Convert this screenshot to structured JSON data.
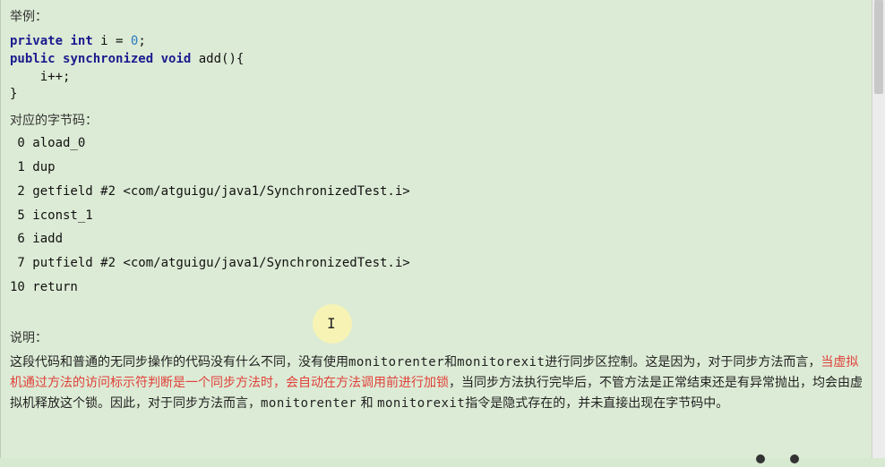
{
  "heading_example": "举例：",
  "code": {
    "line1": {
      "kw1": "private",
      "kw2": "int",
      "rest": " i = ",
      "num": "0",
      "end": ";"
    },
    "line2": {
      "kw1": "public",
      "kw2": "synchronized",
      "kw3": "void",
      "rest": " add(){"
    },
    "line3": "    i++;",
    "line4": "}"
  },
  "heading_bytecode": "对应的字节码：",
  "bytecode": [
    " 0 aload_0",
    " 1 dup",
    " 2 getfield #2 <com/atguigu/java1/SynchronizedTest.i>",
    " 5 iconst_1",
    " 6 iadd",
    " 7 putfield #2 <com/atguigu/java1/SynchronizedTest.i>",
    "10 return"
  ],
  "heading_explain": "说明：",
  "explanation": {
    "p1": "这段代码和普通的无同步操作的代码没有什么不同，没有使用",
    "m1": "monitorenter",
    "p2": "和",
    "m2": "monitorexit",
    "p3": "进行同步区控制。这是因为，对于同步方法而言，",
    "red": "当虚拟机通过方法的访问标示符判断是一个同步方法时，会自动在方法调用前进行加锁",
    "p4": "，当同步方法执行完毕后，不管方法是正常结束还是有异常抛出，均会由虚拟机释放这个锁。因此，对于同步方法而言，",
    "m3": "monitorenter",
    "p5": " 和 ",
    "m4": "monitorexit",
    "p6": "指令是隐式存在的，并未直接出现在字节码中。"
  },
  "colors": {
    "background": "#dcebd5",
    "keyword": "#1b1b8f",
    "number": "#2c7cc0",
    "highlight": "#e0403a"
  },
  "cursor_icon": "i-beam-icon"
}
